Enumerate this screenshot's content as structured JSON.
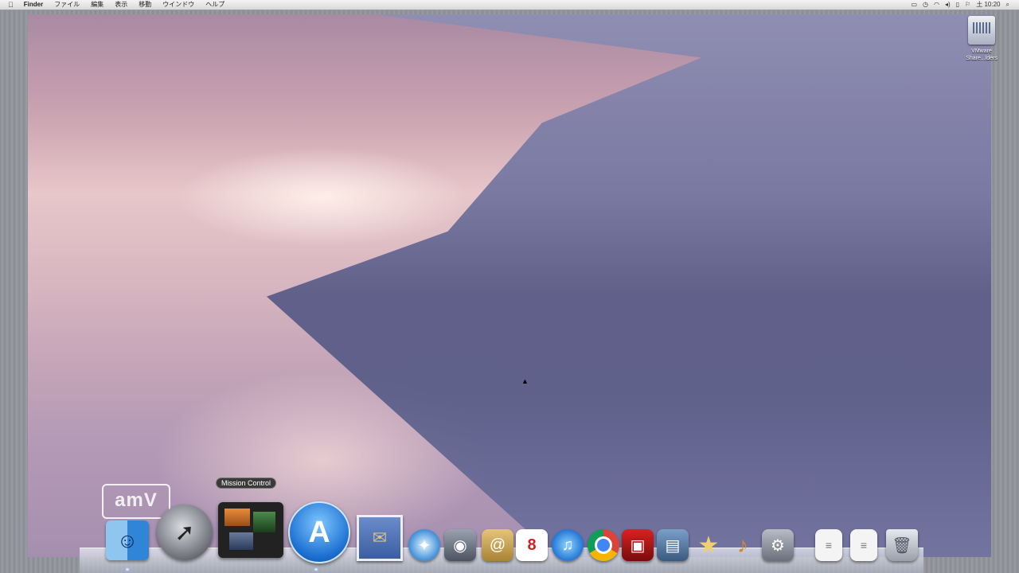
{
  "menubar": {
    "apple": "",
    "items": [
      "Finder",
      "ファイル",
      "編集",
      "表示",
      "移動",
      "ウインドウ",
      "ヘルプ"
    ],
    "clock": "土 10:20"
  },
  "desktop": {
    "drive_icon_label_line1": "VMware",
    "drive_icon_label_line2": "Share...lders"
  },
  "watermark": "amV",
  "dock": {
    "tooltip": "Mission Control",
    "calendar_day": "8",
    "icons": [
      "finder-icon",
      "launchpad-icon",
      "mission-control-icon",
      "app-store-icon",
      "mail-icon",
      "safari-icon",
      "facetime-icon",
      "contacts-icon",
      "calendar-icon",
      "itunes-icon",
      "chrome-icon",
      "photo-booth-icon",
      "preview-icon",
      "imovie-icon",
      "garageband-icon",
      "system-preferences-icon",
      "document-icon",
      "document-icon",
      "trash-icon"
    ]
  }
}
